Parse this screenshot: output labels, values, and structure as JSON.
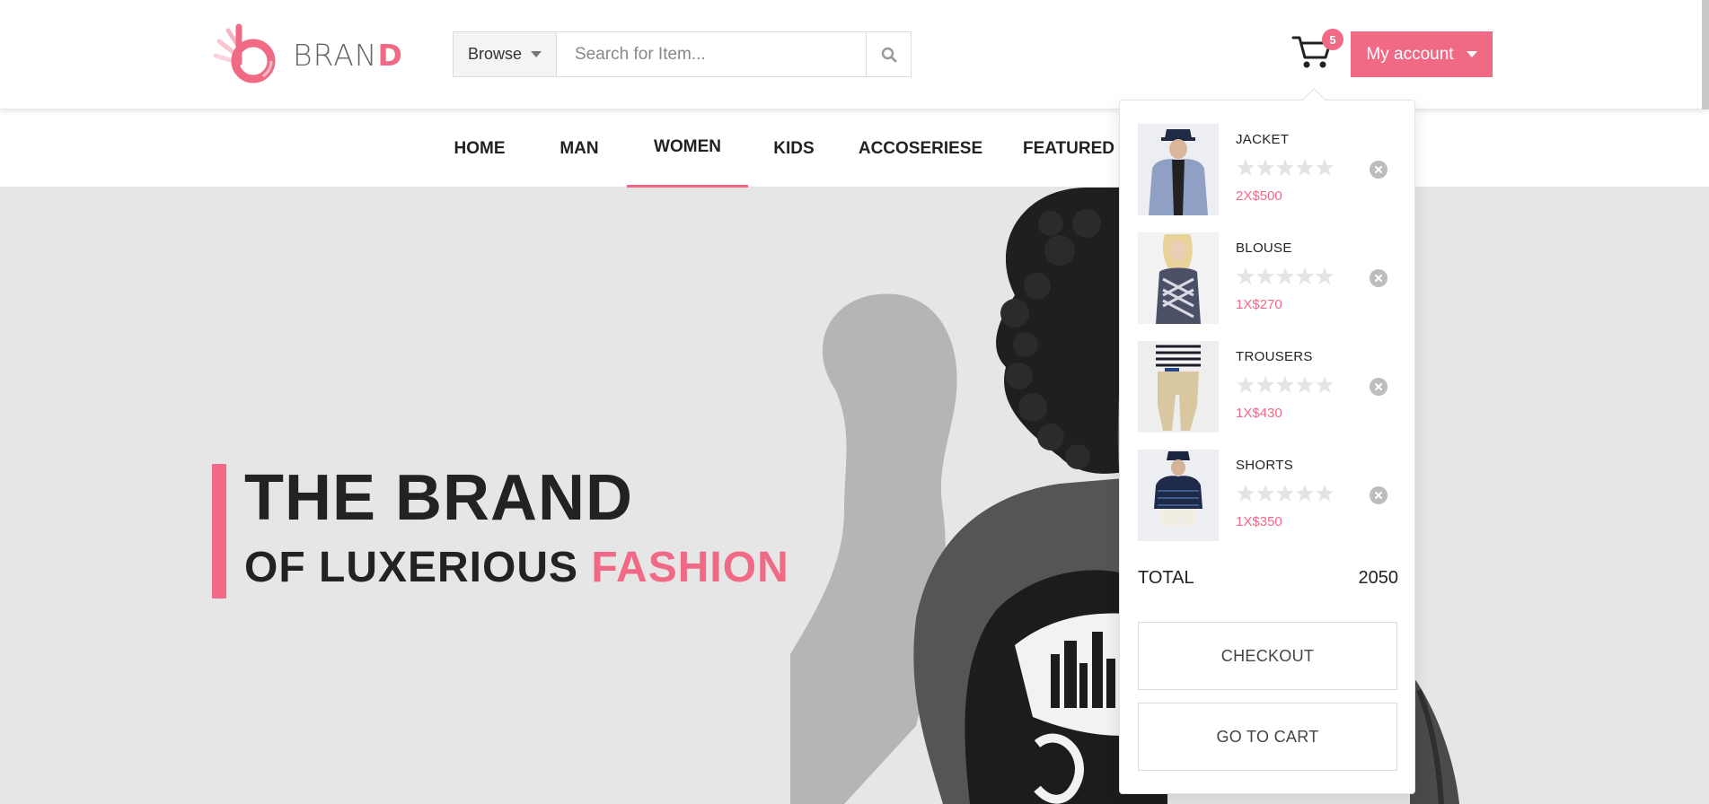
{
  "brand": {
    "text_main": "BRAN",
    "text_accent": "D"
  },
  "search": {
    "browse_label": "Browse",
    "placeholder": "Search for Item...",
    "icon": "search-icon"
  },
  "cart": {
    "count": "5",
    "icon": "cart-icon"
  },
  "account": {
    "label": "My account"
  },
  "nav": {
    "items": [
      {
        "label": "HOME"
      },
      {
        "label": "MAN"
      },
      {
        "label": "WOMEN",
        "active": true
      },
      {
        "label": "KIDS"
      },
      {
        "label": "ACCOSERIESE"
      },
      {
        "label": "FEATURED"
      }
    ]
  },
  "hero": {
    "title_line1": "THE BRAND",
    "title_line2_a": "OF LUXERIOUS",
    "title_line2_b": "FASHION"
  },
  "cart_dropdown": {
    "items": [
      {
        "name": "JACKET",
        "price": "2X$500",
        "rating": 0
      },
      {
        "name": "BLOUSE",
        "price": "1X$270",
        "rating": 0
      },
      {
        "name": "TROUSERS",
        "price": "1X$430",
        "rating": 0
      },
      {
        "name": "SHORTS",
        "price": "1X$350",
        "rating": 0
      }
    ],
    "total_label": "TOTAL",
    "total_value": "2050",
    "checkout_label": "CHECKOUT",
    "go_to_cart_label": "GO TO CART"
  },
  "colors": {
    "accent": "#f06a86",
    "hero_bg": "#e6e6e6",
    "text": "#222222"
  }
}
